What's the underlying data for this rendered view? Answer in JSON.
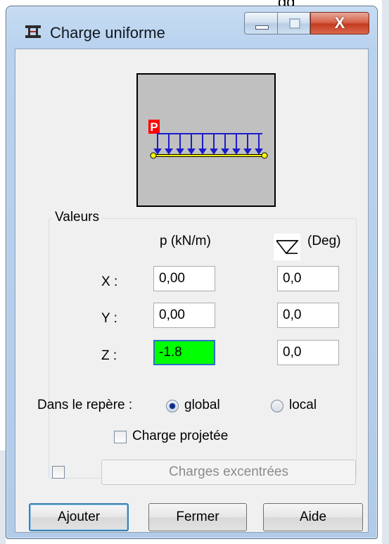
{
  "background": {
    "top_text": "gg"
  },
  "window": {
    "title": "Charge uniforme",
    "controls": {
      "close_glyph": "X"
    }
  },
  "preview": {
    "load_symbol": "P"
  },
  "values_group": {
    "label": "Valeurs",
    "col_p_header": "p  (kN/m)",
    "col_angle_header": "(Deg)",
    "rows": [
      {
        "axis": "X :",
        "p": "0,00",
        "angle": "0,0"
      },
      {
        "axis": "Y :",
        "p": "0,00",
        "angle": "0,0"
      },
      {
        "axis": "Z :",
        "p": "-1.8",
        "angle": "0,0"
      }
    ],
    "repere_label": "Dans le repère :",
    "radio_global": "global",
    "radio_local": "local",
    "selected_repere": "global",
    "projected_label": "Charge projetée",
    "projected_checked": false,
    "excentric_checked": false,
    "excentric_button": "Charges excentrées"
  },
  "buttons": {
    "add": "Ajouter",
    "close": "Fermer",
    "help": "Aide"
  },
  "colors": {
    "active_field": "#00ff00",
    "load_arrows": "#1c1ccc",
    "beam": "#ffff00",
    "load_label": "#ff0000",
    "titlebar": "#c6dcf3",
    "close_button": "#c53b1f"
  }
}
